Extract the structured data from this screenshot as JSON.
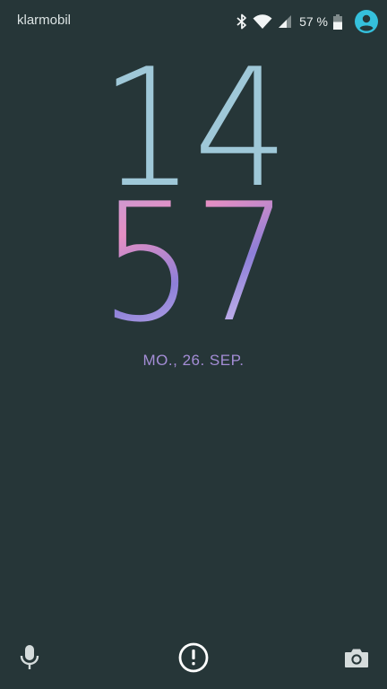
{
  "status_bar": {
    "carrier": "klarmobil",
    "battery_percent": "57 %",
    "battery_level": 0.57,
    "icons": [
      "bluetooth-icon",
      "wifi-icon",
      "signal-icon",
      "battery-icon",
      "user-avatar-icon"
    ]
  },
  "clock": {
    "hours": "14",
    "minutes": "57"
  },
  "date": "MO., 26. SEP.",
  "bottom_actions": {
    "left_icon": "microphone-icon",
    "center_icon": "alert-icon",
    "right_icon": "camera-icon"
  },
  "colors": {
    "background": "#263638",
    "hours": "#9fc8d8",
    "date": "#a48dd6",
    "accent": "#35c0dc"
  }
}
